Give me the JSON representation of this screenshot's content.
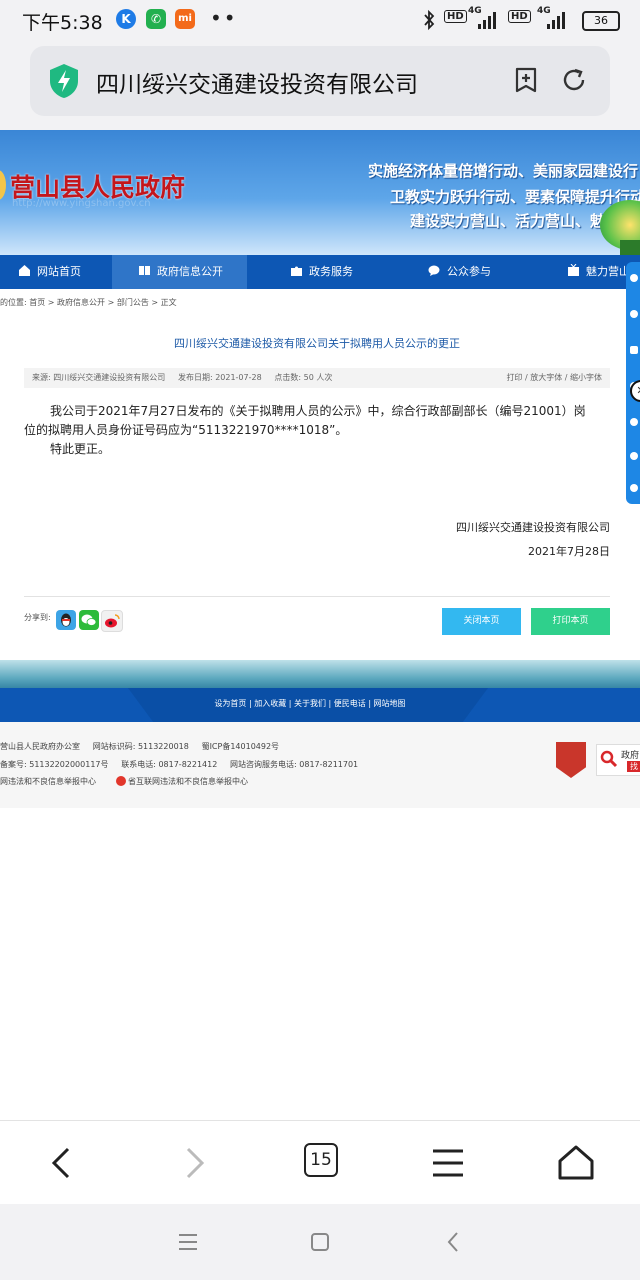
{
  "status_bar": {
    "time": "下午5:38",
    "app_icons": [
      {
        "icon": "k-app-icon",
        "color": "#1e7be6",
        "glyph": "K"
      },
      {
        "icon": "phone-icon",
        "color": "#22b04f",
        "glyph": "✆"
      },
      {
        "icon": "mi-app-icon",
        "color": "#f36a1a",
        "glyph": "mi"
      }
    ],
    "more": "••",
    "hd1": "HD",
    "net1": "4G",
    "hd2": "HD",
    "net2": "4G",
    "battery": "36"
  },
  "url_bar": {
    "title": "四川绥兴交通建设投资有限公司"
  },
  "site": {
    "name": "营山县人民政府",
    "url": "http://www.yingshan.gov.cn",
    "slogans": [
      "实施经济体量倍增行动、美丽家园建设行",
      "卫教实力跃升行动、要素保障提升行动",
      "建设实力营山、活力营山、魅力"
    ],
    "nav": [
      "网站首页",
      "政府信息公开",
      "政务服务",
      "公众参与",
      "魅力营山"
    ]
  },
  "breadcrumb": "的位置: 首页 > 政府信息公开 > 部门公告 > 正文",
  "article": {
    "title": "四川绥兴交通建设投资有限公司关于拟聘用人员公示的更正",
    "meta_left": "来源: 四川绥兴交通建设投资有限公司     发布日期: 2021-07-28     点击数: 50 人次",
    "meta_right": "打印 / 放大字体 / 缩小字体",
    "para1_line1": "我公司于2021年7月27日发布的《关于拟聘用人员的公示》中，综合行政部副部长（编号21001）岗",
    "para1_line2": "位的拟聘用人员身份证号码应为“5113221970****1018”。",
    "para2": "特此更正。",
    "signature_org": "四川绥兴交通建设投资有限公司",
    "signature_date": "2021年7月28日",
    "share_label": "分享到:",
    "close_btn": "关闭本页",
    "print_btn": "打印本页"
  },
  "footer": {
    "links": "设为首页  |  加入收藏  |  关于我们  |  便民电话  |  网站地图",
    "line1": "营山县人民政府办公室     网站标识码: 5113220018     蜀ICP备14010492号",
    "line2": "备案号: 51132202000117号     联系电话: 0817-8221412     网站咨询服务电话: 0817-8211701",
    "line3a": "网违法和不良信息举报中心",
    "line3b": "省互联网违法和不良信息举报中心",
    "badge_right": "政府",
    "badge_right2": "找"
  },
  "browser_bar": {
    "tab_count": "15"
  },
  "colors": {
    "nav_blue": "#0d57b4",
    "close_btn": "#33b8f0",
    "print_btn": "#2fd08c",
    "title_blue": "#1d5aa7"
  }
}
